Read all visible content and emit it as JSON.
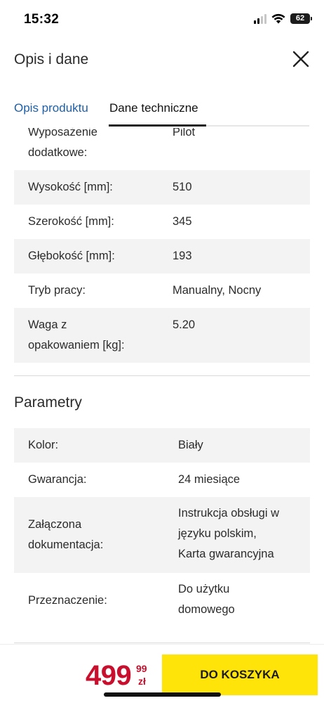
{
  "status_bar": {
    "time": "15:32",
    "battery": "62",
    "icons": [
      "signal-icon",
      "wifi-icon",
      "battery-icon"
    ]
  },
  "header": {
    "title": "Opis i dane",
    "close_icon": "close-icon"
  },
  "tabs": [
    {
      "label": "Opis produktu",
      "active": false,
      "color": "#1e5fa8"
    },
    {
      "label": "Dane techniczne",
      "active": true,
      "color": "#111111"
    }
  ],
  "tech_specs": [
    {
      "label": "Wyposażenie dodatkowe:",
      "label_lines": [
        "Wyposażenie",
        "dodatkowe:"
      ],
      "value": "Pilot"
    },
    {
      "label": "Wysokość [mm]:",
      "value": "510"
    },
    {
      "label": "Szerokość [mm]:",
      "value": "345"
    },
    {
      "label": "Głębokość [mm]:",
      "value": "193"
    },
    {
      "label": "Tryb pracy:",
      "value": "Manualny, Nocny"
    },
    {
      "label": "Waga z opakowaniem [kg]:",
      "label_lines": [
        "Waga z",
        "opakowaniem [kg]:"
      ],
      "value": "5.20"
    }
  ],
  "parameters": {
    "title": "Parametry",
    "rows": [
      {
        "label": "Kolor:",
        "value": "Biały"
      },
      {
        "label": "Gwarancja:",
        "value": "24 miesiące"
      },
      {
        "label": "Załączona dokumentacja:",
        "label_lines": [
          "Załączona",
          "dokumentacja:"
        ],
        "value": "Instrukcja obsługi w języku polskim, Karta gwarancyjna",
        "value_lines": [
          "Instrukcja obsługi w",
          "języku polskim,",
          "Karta gwarancyjna"
        ]
      },
      {
        "label": "Przeznaczenie:",
        "value": "Do użytku domowego",
        "value_lines": [
          "Do użytku",
          "domowego"
        ]
      }
    ]
  },
  "bottom_bar": {
    "price_main": "499",
    "price_cents": "99",
    "currency": "zł",
    "price_color": "#c8102e",
    "cart_button": "DO KOSZYKA",
    "cart_color": "#ffe40a"
  }
}
